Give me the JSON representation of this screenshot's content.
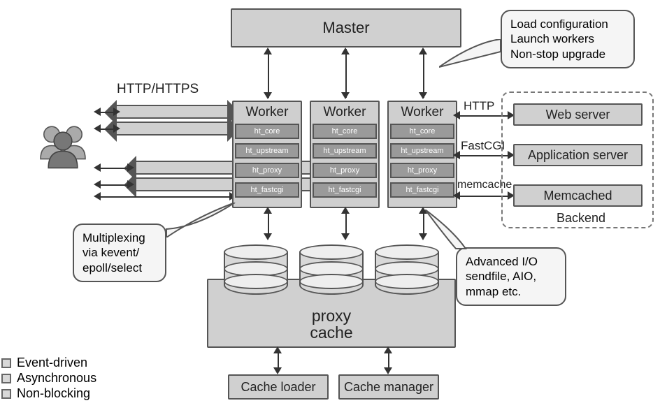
{
  "master": "Master",
  "workers": {
    "title": "Worker",
    "modules": [
      "ht_core",
      "ht_upstream",
      "ht_proxy",
      "ht_fastcgi"
    ]
  },
  "backend": {
    "title": "Backend",
    "web": "Web server",
    "app": "Application server",
    "mem": "Memcached"
  },
  "proxy": {
    "line1": "proxy",
    "line2": "cache"
  },
  "cacheloader": "Cache loader",
  "cachemanager": "Cache manager",
  "labels": {
    "httphttps": "HTTP/HTTPS",
    "http": "HTTP",
    "fastcgi": "FastCGI",
    "memcache": "memcache"
  },
  "callouts": {
    "master": [
      "Load configuration",
      "Launch workers",
      "Non-stop upgrade"
    ],
    "mux": [
      "Multiplexing",
      "via kevent/",
      "epoll/select"
    ],
    "aio": [
      "Advanced I/O",
      "sendfile, AIO,",
      "mmap etc."
    ]
  },
  "legend": [
    "Event-driven",
    "Asynchronous",
    "Non-blocking"
  ]
}
